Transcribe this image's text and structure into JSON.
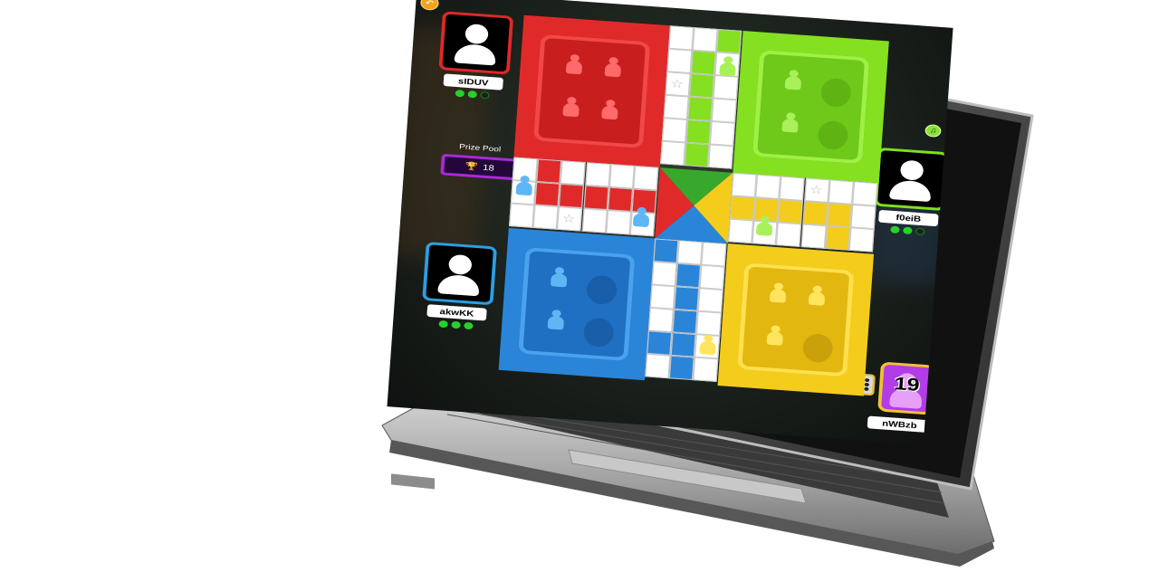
{
  "game": {
    "prize_pool_label": "Prize Pool",
    "prize_pool_value": "18",
    "timer_value": "19"
  },
  "players": {
    "red": {
      "name": "sIDUV",
      "color": "#e02828",
      "active_dots": 2,
      "total_dots": 3
    },
    "green": {
      "name": "f0eiB",
      "color": "#7ee11c",
      "active_dots": 2,
      "total_dots": 3
    },
    "blue": {
      "name": "akwKK",
      "color": "#2a9fe4",
      "active_dots": 3,
      "total_dots": 3
    },
    "yellow": {
      "name": "nWBzb",
      "color": "#f2c230"
    }
  },
  "icons": {
    "back": "back-arrow-icon",
    "sound": "speaker-icon",
    "trophy": "trophy-icon",
    "dice": "dice-icon",
    "star": "star-icon"
  },
  "colors": {
    "red": "#e02a2a",
    "green": "#84e020",
    "blue": "#2a85d8",
    "yellow": "#f4cc1c",
    "prize_accent": "#a82ad8"
  }
}
